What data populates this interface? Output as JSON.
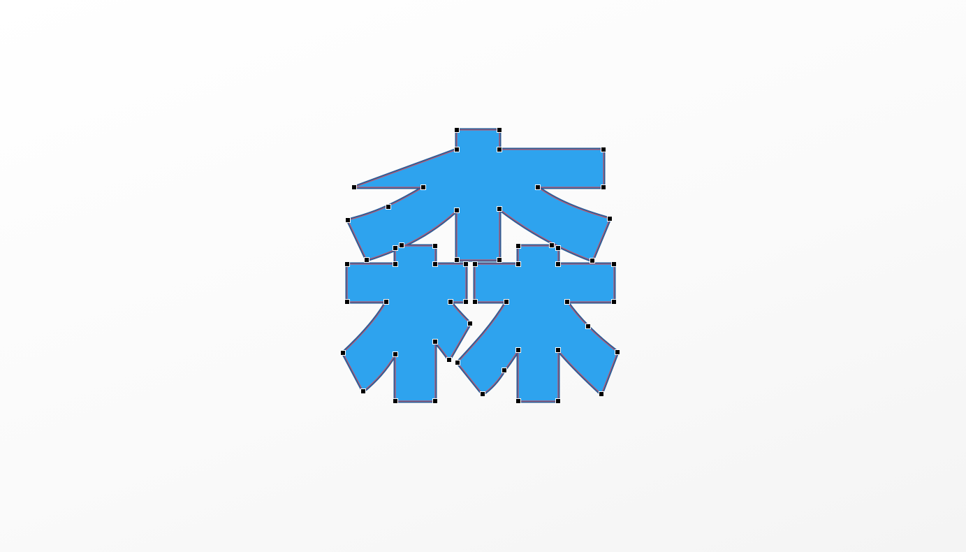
{
  "canvas": {
    "background": "#ffffff"
  },
  "shape": {
    "character": "森",
    "fill_color": "#2ea3ee",
    "outline_color": "#2c5d96",
    "path_color": "#c0566a",
    "anchor_handle_color": "#000000"
  }
}
